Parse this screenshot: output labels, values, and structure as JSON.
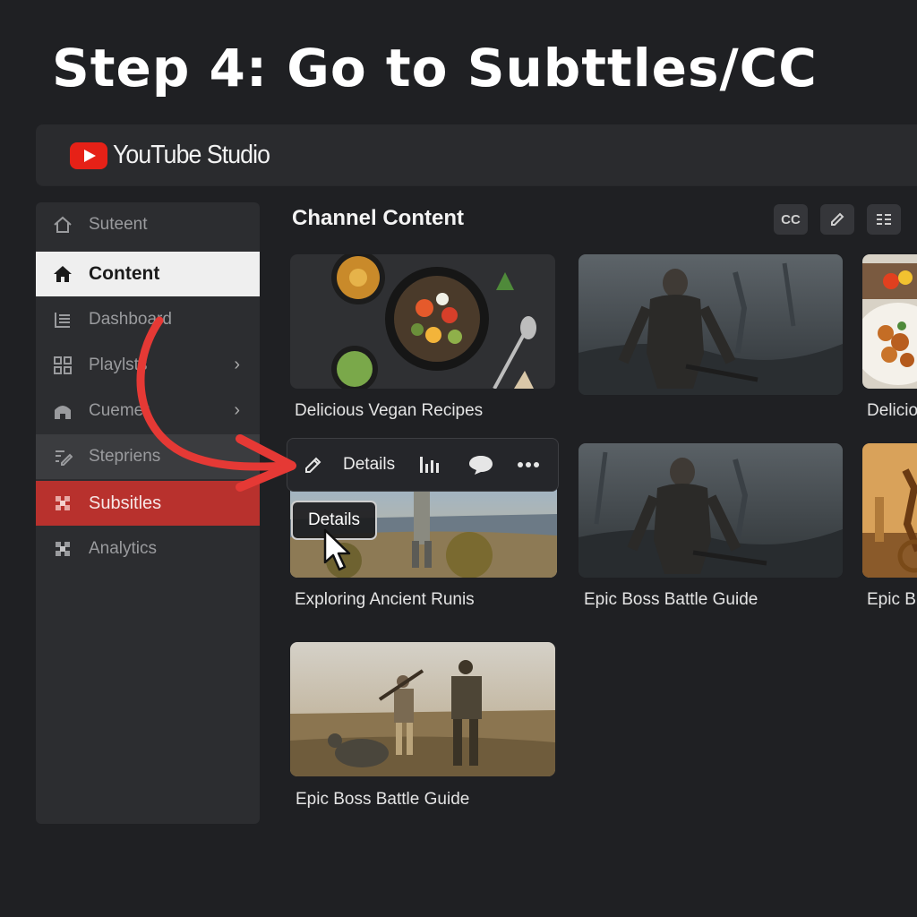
{
  "step_title": "Step 4: Go to Subttles/CC",
  "app": {
    "name": "YouTube Studio",
    "brand_color": "#e62117"
  },
  "sidebar": {
    "items": [
      {
        "label": "Suteent",
        "icon": "home-outline-icon"
      },
      {
        "label": "Content",
        "icon": "home-filled-icon",
        "active": true
      },
      {
        "label": "Dashboard",
        "icon": "list-icon"
      },
      {
        "label": "Playlsts",
        "icon": "grid-icon",
        "chevron": "›"
      },
      {
        "label": "Cuemer",
        "icon": "building-icon",
        "chevron": "›"
      },
      {
        "label": "Stepriens",
        "icon": "edit-steps-icon"
      },
      {
        "label": "Subsitles",
        "icon": "subtitles-icon",
        "highlight_color": "#b8312d"
      },
      {
        "label": "Analytics",
        "icon": "analytics-icon"
      }
    ]
  },
  "main": {
    "title": "Channel Content",
    "toolbar": [
      {
        "label": "CC",
        "icon": "cc-icon"
      },
      {
        "label": "",
        "icon": "pencil-icon"
      },
      {
        "label": "",
        "icon": "list-settings-icon"
      }
    ],
    "videos": [
      {
        "title": "Delicious Vegan Recipes",
        "thumb": "food"
      },
      {
        "title": "",
        "thumb": "warrior"
      },
      {
        "title": "Delicio",
        "thumb": "food2"
      },
      {
        "title": "Exploring Ancient Runis",
        "thumb": "hiker"
      },
      {
        "title": "Epic Boss Battle Guide",
        "thumb": "warrior"
      },
      {
        "title": "Epic B",
        "thumb": "ruins"
      },
      {
        "title": "Epic Boss Battle Guide",
        "thumb": "soldiers"
      }
    ],
    "hover_actions": {
      "details_label": "Details",
      "icons": [
        "pencil-icon",
        "analytics-bars-icon",
        "comment-icon",
        "more-icon"
      ]
    },
    "tooltip": "Details"
  },
  "annotation_arrow_color": "#e53935"
}
